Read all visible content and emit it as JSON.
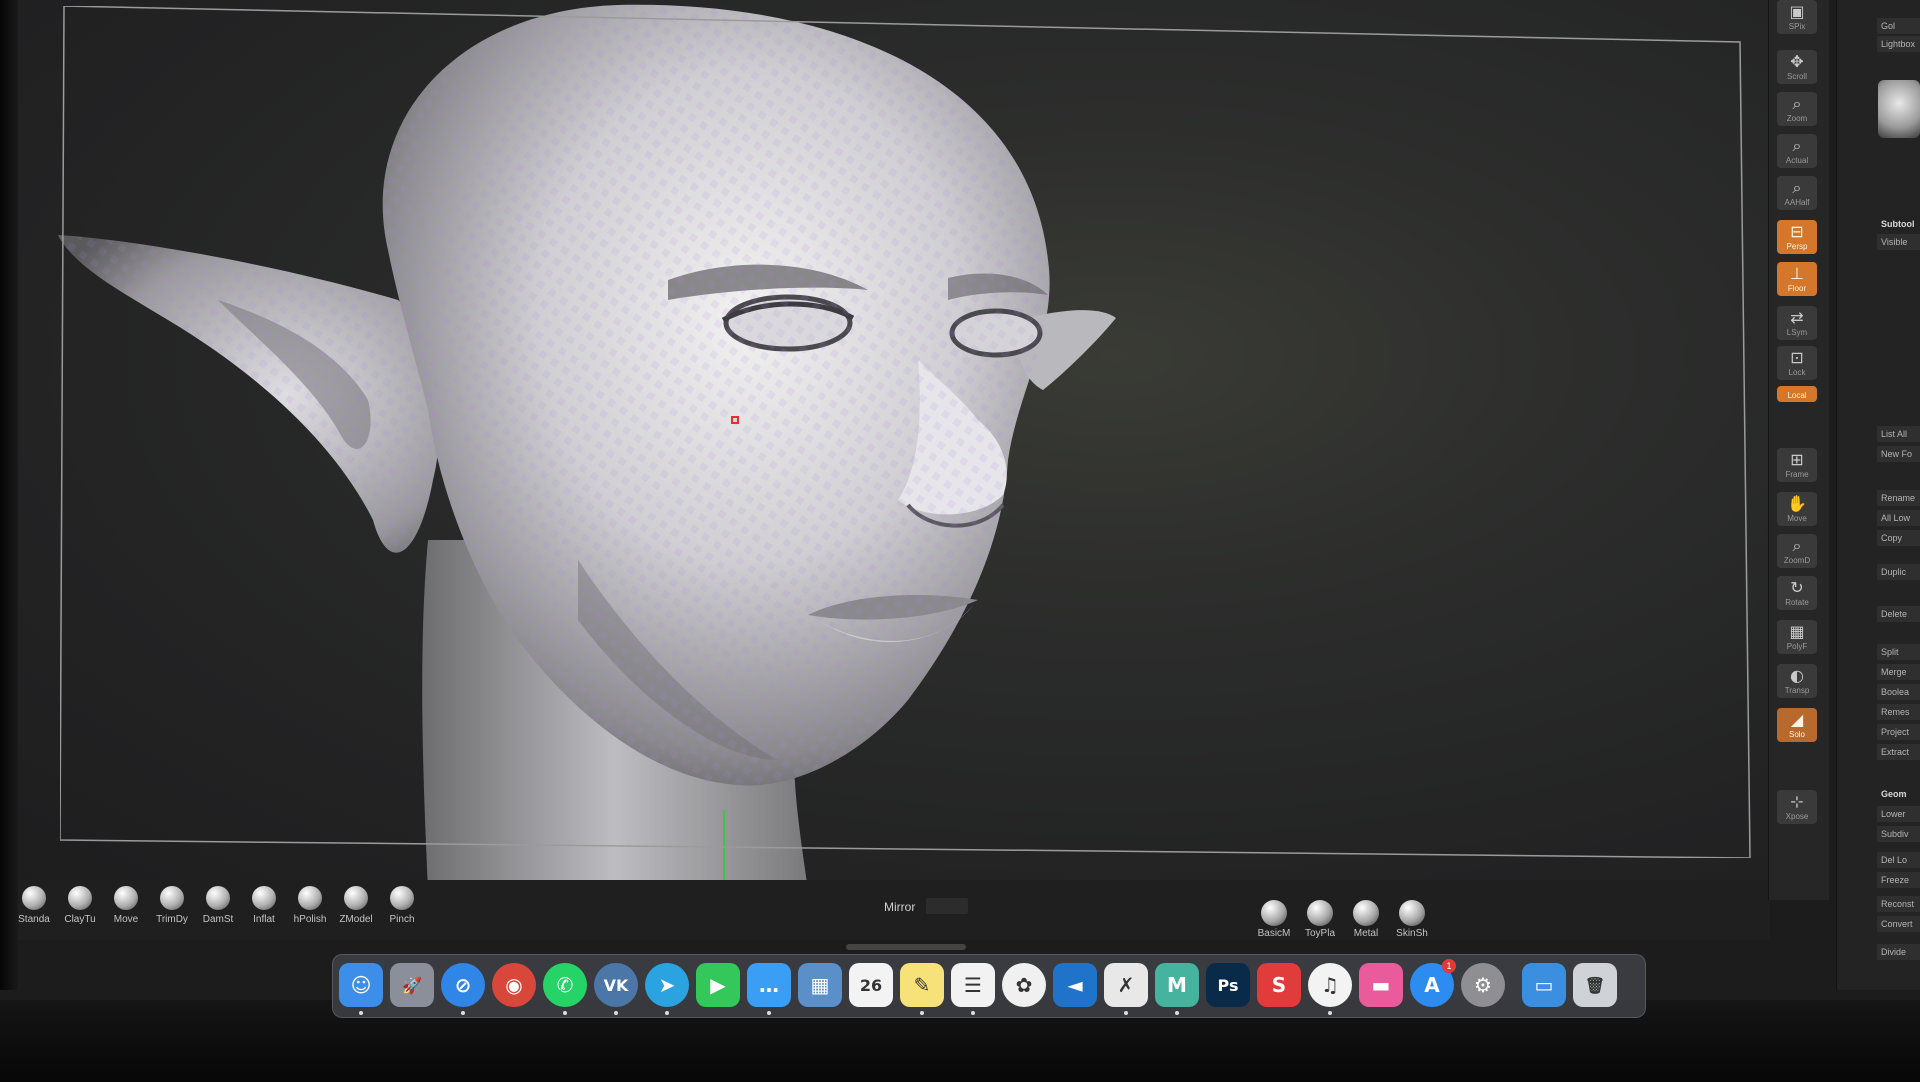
{
  "right_palette": {
    "tools": [
      {
        "label": "SPix",
        "icon": "spix-icon"
      },
      {
        "label": "Scroll",
        "icon": "scroll-icon"
      },
      {
        "label": "Zoom",
        "icon": "zoom-icon"
      },
      {
        "label": "Actual",
        "icon": "actual-icon"
      },
      {
        "label": "AAHalf",
        "icon": "aahalf-icon"
      },
      {
        "label": "Persp",
        "icon": "persp-icon"
      },
      {
        "label": "Floor",
        "icon": "floor-icon"
      },
      {
        "label": "LSym",
        "icon": "lsym-icon"
      },
      {
        "label": "Lock",
        "icon": "lock-icon"
      },
      {
        "label": "Local",
        "icon": "local-icon"
      },
      {
        "label": "Frame",
        "icon": "frame-icon"
      },
      {
        "label": "Move",
        "icon": "move-icon"
      },
      {
        "label": "ZoomD",
        "icon": "zoomd-icon"
      },
      {
        "label": "Rotate",
        "icon": "rotate-icon"
      },
      {
        "label": "PolyF",
        "icon": "polyf-icon"
      },
      {
        "label": "Transp",
        "icon": "transp-icon"
      },
      {
        "label": "Solo",
        "icon": "solo-icon"
      },
      {
        "label": "Xpose",
        "icon": "xpose-icon"
      }
    ]
  },
  "far_panel": {
    "items": [
      "Gol",
      "Lightbox",
      "Subtool",
      "Visible",
      "List All",
      "New Fo",
      "Rename",
      "All Low",
      "Copy",
      "Duplic",
      "Delete",
      "Split",
      "Merge",
      "Boolea",
      "Remes",
      "Project",
      "Extract",
      "Geom",
      "Lower",
      "Subdiv",
      "Del Lo",
      "Freeze",
      "Reconst",
      "Convert",
      "Divide"
    ]
  },
  "brush_shelf": {
    "brushes": [
      "Standa",
      "ClayTu",
      "Move",
      "TrimDy",
      "DamSt",
      "Inflat",
      "hPolish",
      "ZModel",
      "Pinch"
    ],
    "mirror_label": "Mirror",
    "materials": [
      "BasicM",
      "ToyPla",
      "Metal",
      "SkinSh"
    ]
  },
  "dock": {
    "apps": [
      {
        "name": "Finder",
        "icon": "finder-icon",
        "color": "#3d8ee8",
        "glyph": "☺"
      },
      {
        "name": "Launchpad",
        "icon": "launchpad-icon",
        "color": "#8a8f99",
        "glyph": "🚀"
      },
      {
        "name": "Safari",
        "icon": "safari-icon",
        "color": "#2f86e6",
        "glyph": "⊘"
      },
      {
        "name": "Chrome",
        "icon": "chrome-icon",
        "color": "#d9473a",
        "glyph": "◉"
      },
      {
        "name": "WhatsApp",
        "icon": "whatsapp-icon",
        "color": "#25d366",
        "glyph": "✆"
      },
      {
        "name": "VK",
        "icon": "vk-icon",
        "color": "#4a76a8",
        "glyph": "VK"
      },
      {
        "name": "Telegram",
        "icon": "telegram-icon",
        "color": "#2aa3e0",
        "glyph": "➤"
      },
      {
        "name": "FaceTime",
        "icon": "facetime-icon",
        "color": "#34c759",
        "glyph": "▶"
      },
      {
        "name": "Messages",
        "icon": "messages-icon",
        "color": "#3a9ef5",
        "glyph": "…"
      },
      {
        "name": "Preview",
        "icon": "preview-icon",
        "color": "#5b8fc7",
        "glyph": "▦"
      },
      {
        "name": "Calendar",
        "icon": "calendar-icon",
        "color": "#f3f3f3",
        "glyph": "26"
      },
      {
        "name": "Notes",
        "icon": "notes-icon",
        "color": "#f7e27a",
        "glyph": "✎"
      },
      {
        "name": "Reminders",
        "icon": "reminders-icon",
        "color": "#f2f2f2",
        "glyph": "☰"
      },
      {
        "name": "Photos",
        "icon": "photos-icon",
        "color": "#f0f0f0",
        "glyph": "✿"
      },
      {
        "name": "VS Code",
        "icon": "vscode-icon",
        "color": "#1f73c9",
        "glyph": "◄"
      },
      {
        "name": "ZBrush",
        "icon": "zbrush-icon",
        "color": "#e8e8e8",
        "glyph": "✗"
      },
      {
        "name": "Marvelous",
        "icon": "marvelous-icon",
        "color": "#45b39d",
        "glyph": "M"
      },
      {
        "name": "Photoshop",
        "icon": "photoshop-icon",
        "color": "#0a2a4a",
        "glyph": "Ps"
      },
      {
        "name": "Substance",
        "icon": "substance-icon",
        "color": "#e23b3b",
        "glyph": "S"
      },
      {
        "name": "iTunes",
        "icon": "itunes-icon",
        "color": "#f3f3f3",
        "glyph": "♫"
      },
      {
        "name": "Folder",
        "icon": "pink-folder-icon",
        "color": "#e95b9b",
        "glyph": "▬"
      },
      {
        "name": "App Store",
        "icon": "appstore-icon",
        "color": "#2d8cf0",
        "glyph": "A"
      },
      {
        "name": "System Preferences",
        "icon": "settings-icon",
        "color": "#8e8e93",
        "glyph": "⚙"
      },
      {
        "name": "Downloads",
        "icon": "downloads-folder-icon",
        "color": "#3a8fe0",
        "glyph": "▭"
      },
      {
        "name": "Trash",
        "icon": "trash-icon",
        "color": "#cfd3d8",
        "glyph": "🗑"
      }
    ],
    "calendar_day": "26",
    "appstore_badge": "1"
  }
}
